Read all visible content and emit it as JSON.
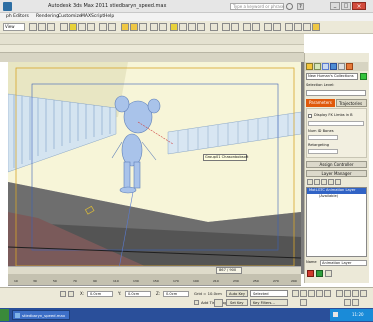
{
  "window": {
    "title": "Autodesk 3ds Max  2011     stiedbaryn_speed.max",
    "menu": [
      "ph Editors",
      "Rendering",
      "Customize",
      "MAXScript",
      "Help"
    ],
    "search_placeholder": "Type a keyword or phrase",
    "help_icon": "?",
    "min_icon": "_",
    "max_icon": "□",
    "close_icon": "×"
  },
  "toolbar": {
    "view_dropdown": "View",
    "view_btn": "▾"
  },
  "viewport": {
    "object_tooltip": "Group01 Chasonbobsoft",
    "coord_readout": "867 / 900"
  },
  "command_panel": {
    "name_field": "New Human's Collections",
    "selection_level_label": "Selection Level:",
    "tabs": [
      "Parameters",
      "Trajectories"
    ],
    "display_fk_limbs": "Display FK Limbs in B",
    "num_bones_label": "Num ID Bones",
    "retargeting_label": "Retargeting",
    "assign_controller": "Assign Controller",
    "layer_manager": "Layer Manager",
    "layer_list": [
      "MotLGTC Animation Layer",
      "(Available)"
    ],
    "name_label": "Name",
    "name_value": "Animation Layer"
  },
  "timeline": {
    "frame_label": "867 / 900",
    "ticks": [
      "10",
      "20",
      "30",
      "40",
      "50",
      "60",
      "70",
      "80",
      "90",
      "100",
      "110",
      "120",
      "130",
      "140",
      "150",
      "160",
      "170",
      "180",
      "190",
      "200",
      "210",
      "220",
      "230",
      "240",
      "250",
      "260",
      "270",
      "280",
      "290",
      "300"
    ]
  },
  "status_bar": {
    "x_label": "X:",
    "x_value": "0.0cm",
    "y_label": "Y:",
    "y_value": "0.0cm",
    "z_label": "Z:",
    "z_value": "0.0cm",
    "grid_label": "Grid = 10.0cm",
    "add_time_tag": "Add Time Tag",
    "auto_key": "Auto Key",
    "selected": "Selected",
    "set_key": "Set Key",
    "key_filters": "Key Filters..."
  },
  "taskbar": {
    "task_item": "stiedbaryn_speed.max",
    "clock": "11:20"
  },
  "colors": {
    "title_bar": "#ececec",
    "viewport_bg": "#9c9c9c",
    "panel_bg": "#ece9d8",
    "selected_layer": "#3163c5",
    "taskbar": "#2a4f9a"
  }
}
